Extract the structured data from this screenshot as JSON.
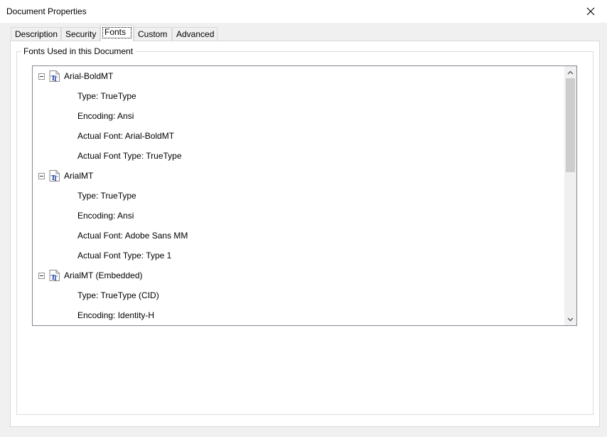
{
  "window": {
    "title": "Document Properties"
  },
  "tabs": [
    {
      "label": "Description"
    },
    {
      "label": "Security"
    },
    {
      "label": "Fonts",
      "active": true
    },
    {
      "label": "Custom"
    },
    {
      "label": "Advanced"
    }
  ],
  "fonts_group": {
    "label": "Fonts Used in this Document",
    "fonts": [
      {
        "name": "Arial-BoldMT",
        "details": [
          "Type: TrueType",
          "Encoding: Ansi",
          "Actual Font: Arial-BoldMT",
          "Actual Font Type: TrueType"
        ]
      },
      {
        "name": "ArialMT",
        "details": [
          "Type: TrueType",
          "Encoding: Ansi",
          "Actual Font: Adobe Sans MM",
          "Actual Font Type: Type 1"
        ]
      },
      {
        "name": "ArialMT (Embedded)",
        "details": [
          "Type: TrueType (CID)",
          "Encoding: Identity-H"
        ]
      }
    ]
  },
  "icons": {
    "close": "close-icon",
    "font": "truetype-font-icon",
    "expander": "collapse-icon",
    "scroll_up": "chevron-up-icon",
    "scroll_down": "chevron-down-icon"
  },
  "colors": {
    "icon_blue": "#1a3c9c",
    "window_bg": "#f0f0f0",
    "panel_bg": "#ffffff"
  }
}
